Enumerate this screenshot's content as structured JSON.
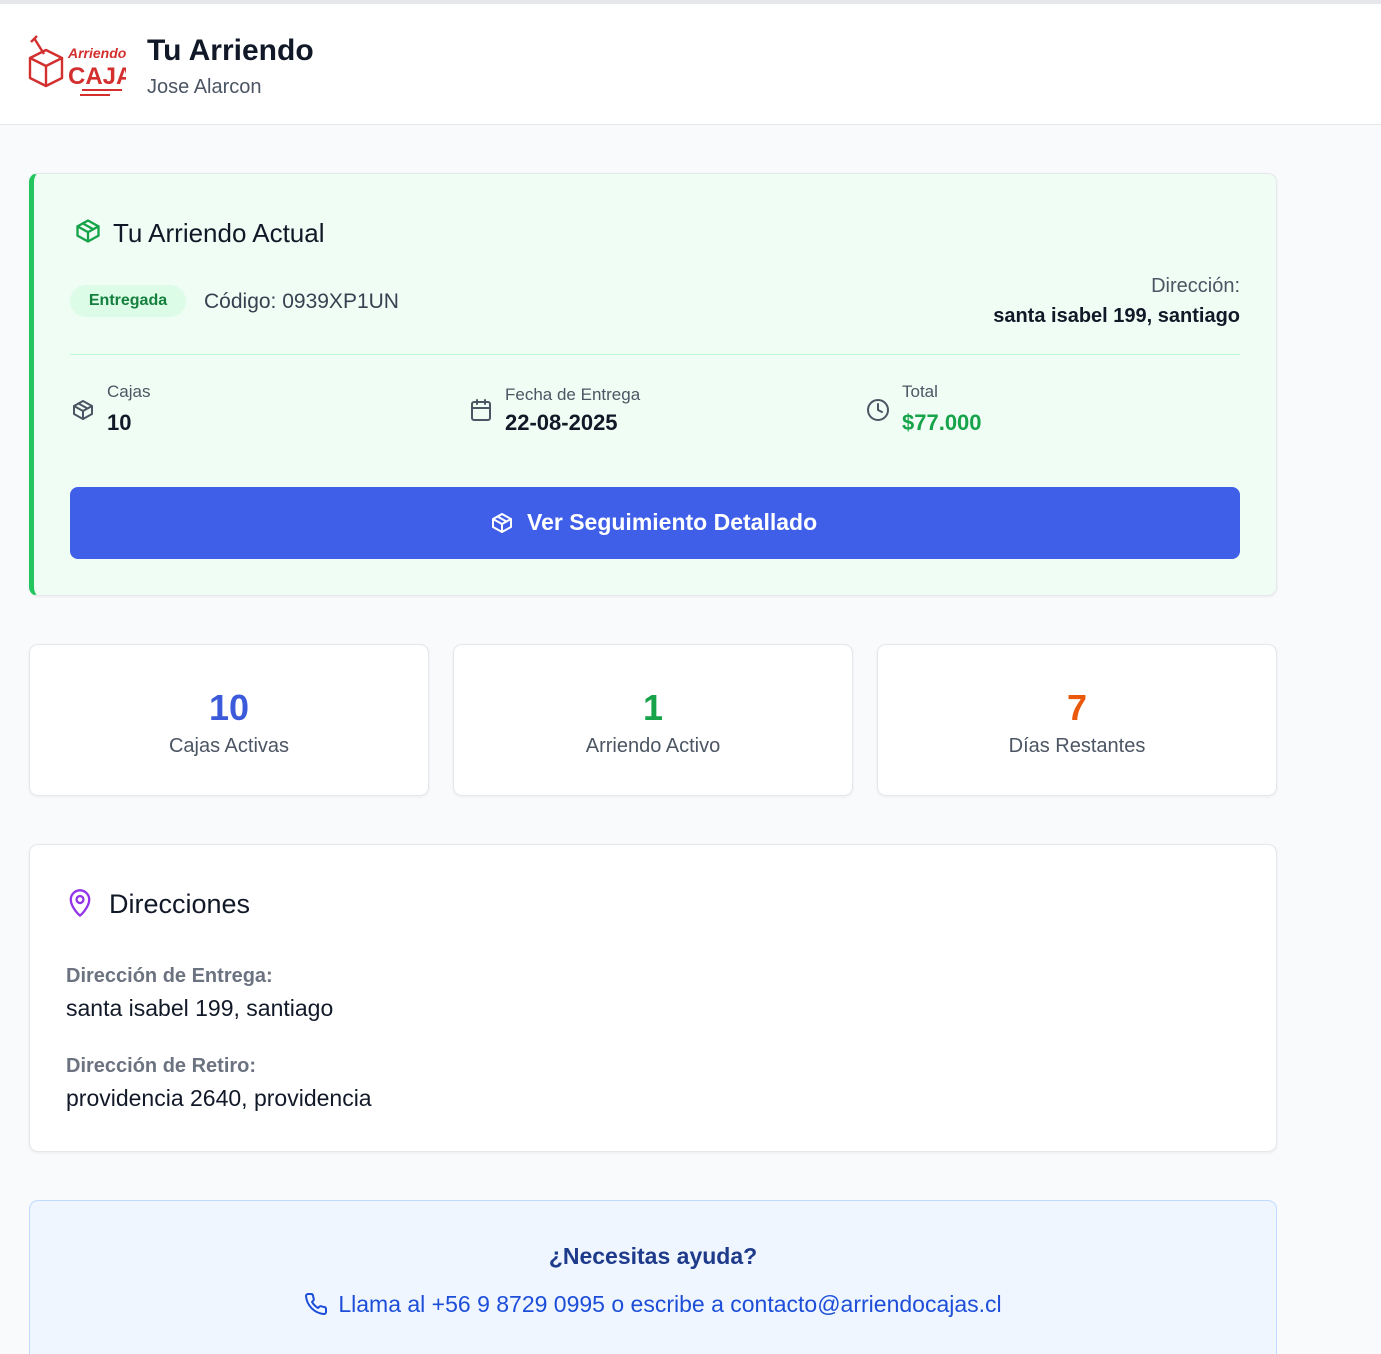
{
  "header": {
    "logo_text_top": "Arriendo",
    "logo_text_bottom": "CAJAS",
    "title": "Tu Arriendo",
    "user_name": "Jose Alarcon"
  },
  "current_rental": {
    "title": "Tu Arriendo Actual",
    "status": "Entregada",
    "code": "Código: 0939XP1UN",
    "address_label": "Dirección:",
    "address": "santa isabel 199, santiago",
    "boxes_label": "Cajas",
    "boxes_value": "10",
    "delivery_label": "Fecha de Entrega",
    "delivery_value": "22-08-2025",
    "total_label": "Total",
    "total_value": "$77.000",
    "track_button": "Ver Seguimiento Detallado"
  },
  "metrics": [
    {
      "value": "10",
      "label": "Cajas Activas",
      "color": "#3b5bdb"
    },
    {
      "value": "1",
      "label": "Arriendo Activo",
      "color": "#16a34a"
    },
    {
      "value": "7",
      "label": "Días Restantes",
      "color": "#ea580c"
    }
  ],
  "addresses": {
    "title": "Direcciones",
    "delivery_label": "Dirección de Entrega:",
    "delivery_value": "santa isabel 199, santiago",
    "pickup_label": "Dirección de Retiro:",
    "pickup_value": "providencia 2640, providencia"
  },
  "help": {
    "title": "¿Necesitas ayuda?",
    "text": "Llama al +56 9 8729 0995 o escribe a contacto@arriendocajas.cl"
  },
  "colors": {
    "accent": "#3f5fe9",
    "success": "#22c55e",
    "logo_red": "#d32f2f",
    "pin_purple": "#9333ea"
  },
  "icons": [
    "box-icon",
    "calendar-icon",
    "clock-icon",
    "map-pin-icon",
    "phone-icon"
  ]
}
